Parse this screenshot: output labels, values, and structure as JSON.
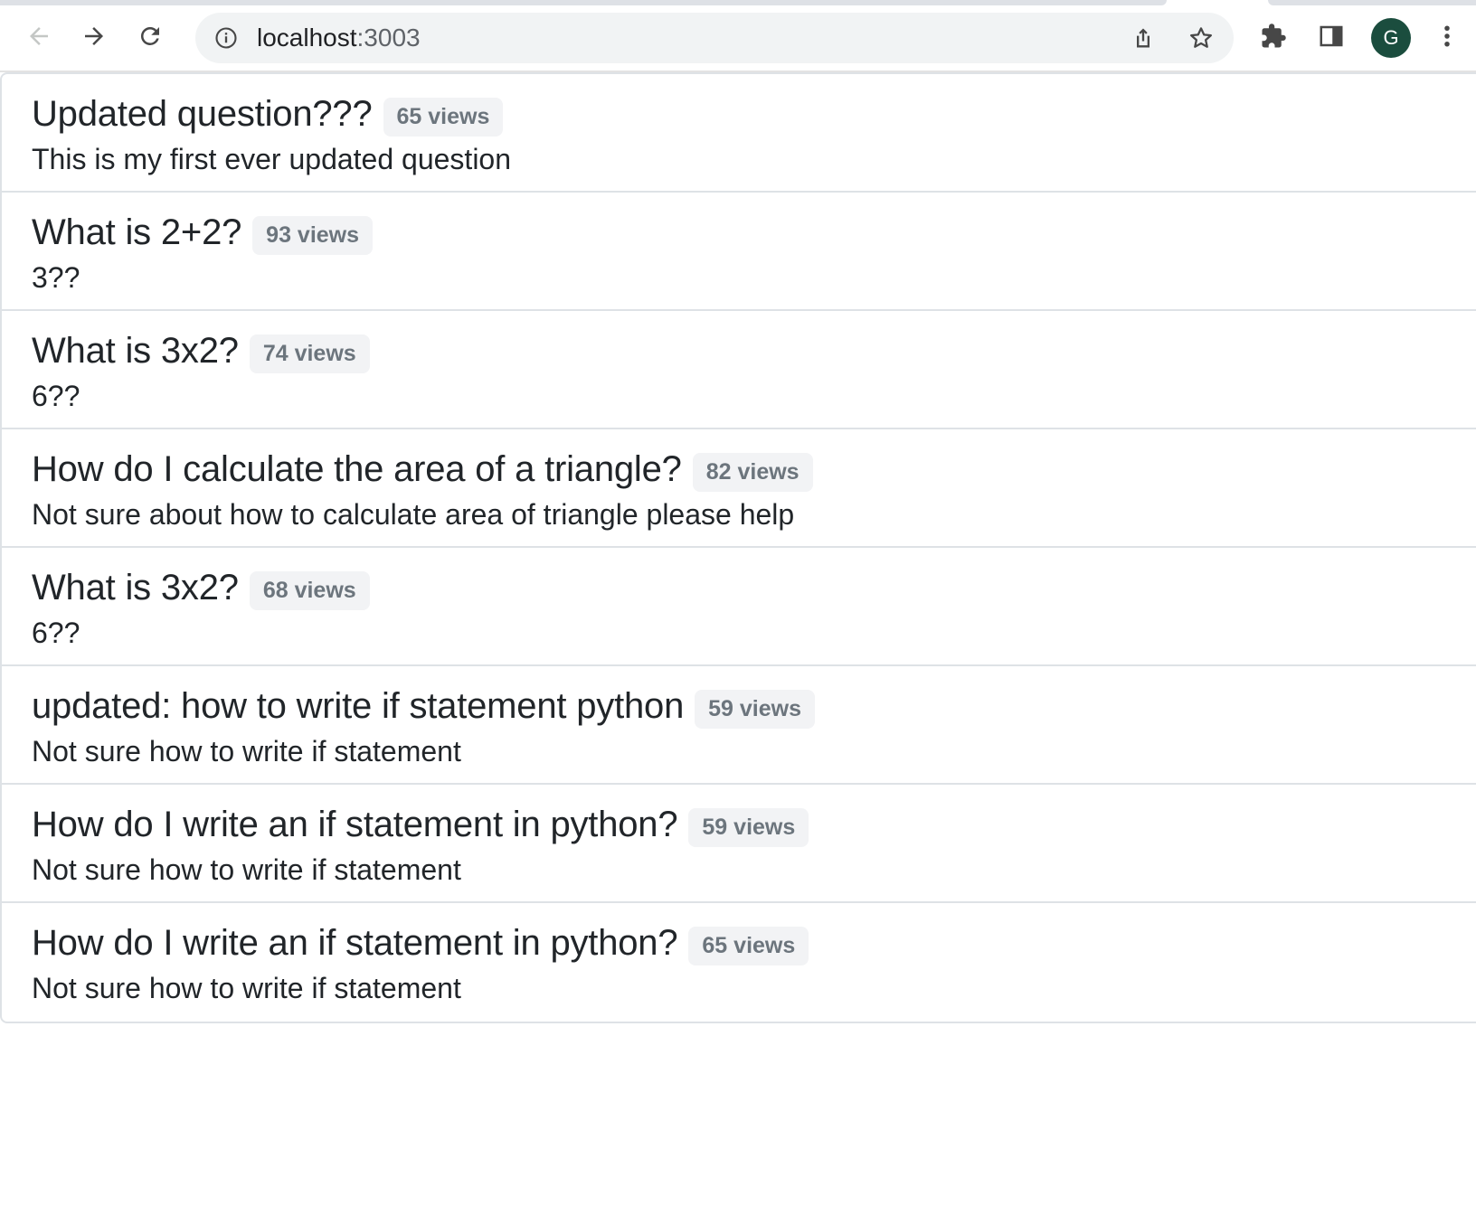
{
  "browser": {
    "url_host": "localhost",
    "url_port": ":3003",
    "profile_initial": "G",
    "icons": {
      "back": "arrow-left-icon",
      "forward": "arrow-right-icon",
      "reload": "reload-icon",
      "site_info": "info-icon",
      "share": "share-icon",
      "bookmark": "star-icon",
      "extensions": "puzzle-icon",
      "side_panel": "side-panel-icon",
      "menu": "kebab-menu-icon"
    },
    "colors": {
      "avatar_bg": "#1b4d3e",
      "omnibox_bg": "#f1f3f4"
    }
  },
  "questions": [
    {
      "title": "Updated question???",
      "views": "65 views",
      "body": "This is my first ever updated question"
    },
    {
      "title": "What is 2+2?",
      "views": "93 views",
      "body": "3??"
    },
    {
      "title": "What is 3x2?",
      "views": "74 views",
      "body": "6??"
    },
    {
      "title": "How do I calculate the area of a triangle?",
      "views": "82 views",
      "body": "Not sure about how to calculate area of triangle please help"
    },
    {
      "title": "What is 3x2?",
      "views": "68 views",
      "body": "6??"
    },
    {
      "title": "updated: how to write if statement python",
      "views": "59 views",
      "body": "Not sure how to write if statement"
    },
    {
      "title": "How do I write an if statement in python?",
      "views": "59 views",
      "body": "Not sure how to write if statement"
    },
    {
      "title": "How do I write an if statement in python?",
      "views": "65 views",
      "body": "Not sure how to write if statement"
    }
  ]
}
